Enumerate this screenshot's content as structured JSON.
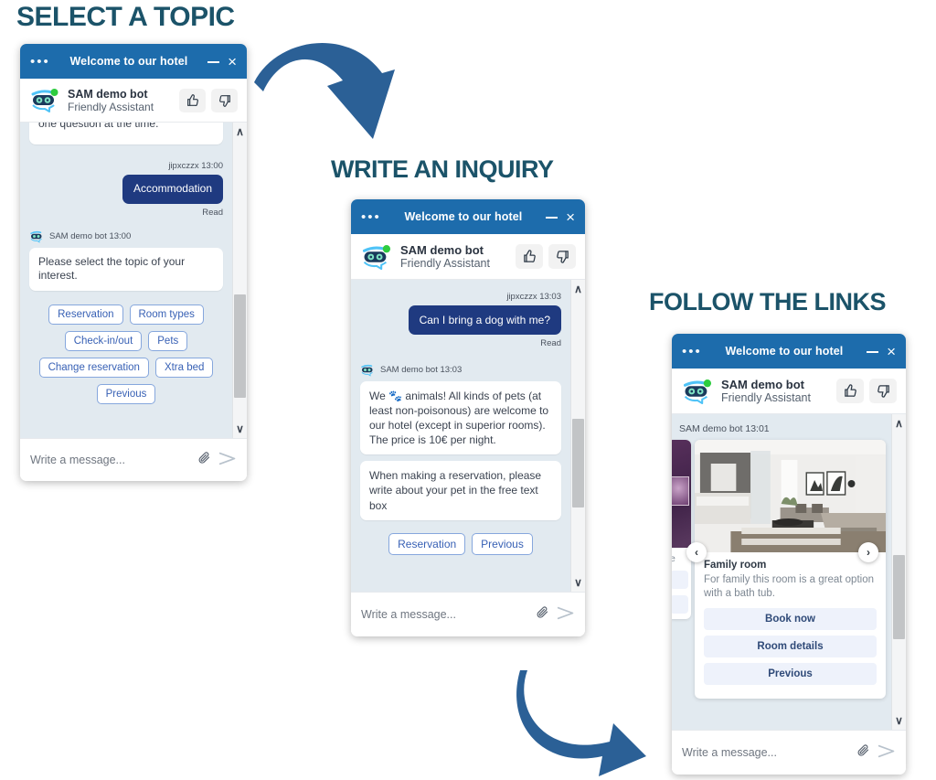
{
  "steps": [
    {
      "title": "SELECT A TOPIC"
    },
    {
      "title": "WRITE AN INQUIRY"
    },
    {
      "title": "FOLLOW THE LINKS"
    }
  ],
  "widget_common": {
    "header_title": "Welcome to our hotel",
    "menu_dots": "•••",
    "minimize_label": "Minimize",
    "close_label": "×",
    "bot_name": "SAM demo bot",
    "bot_role": "Friendly Assistant",
    "thumbs_up": "thumbs-up",
    "thumbs_down": "thumbs-down",
    "input_placeholder": "Write a message...",
    "attach_label": "📎",
    "send_label": "➤",
    "scroll_up": "∧",
    "scroll_down": "∨",
    "header_color": "#1d6cac",
    "user_bubble_color": "#1f3a80",
    "chip_border_color": "#86a7dd",
    "chip_text_color": "#3861b5",
    "body_color": "#e2eaf0",
    "title_color": "#1b5369",
    "arrow_color": "#2b6096"
  },
  "widget1": {
    "partial_message": "one question at the time.",
    "user_meta": "jipxczzx 13:00",
    "user_message": "Accommodation",
    "read_label": "Read",
    "bot_meta": "SAM demo bot 13:00",
    "bot_message": "Please select the topic of your interest.",
    "chips": [
      "Reservation",
      "Room types",
      "Check-in/out",
      "Pets",
      "Change reservation",
      "Xtra bed",
      "Previous"
    ]
  },
  "widget2": {
    "user_meta": "jipxczzx 13:03",
    "user_message": "Can I bring a dog with me?",
    "read_label": "Read",
    "bot_meta": "SAM demo bot 13:03",
    "bot_message_1": "We 🐾 animals! All kinds of pets (at least non-poisonous) are welcome to our hotel (except in superior rooms). The price is 10€ per night.",
    "bot_message_2": "When making a reservation, please write about your pet in the free text box",
    "chips": [
      "Reservation",
      "Previous"
    ],
    "input_value": ""
  },
  "widget3": {
    "bot_meta": "SAM demo bot 13:01",
    "card": {
      "title": "Family room",
      "description": "For family this room is a great option with a bath tub.",
      "buttons": [
        "Book now",
        "Room details",
        "Previous"
      ]
    },
    "nav_prev": "‹",
    "nav_next": "›",
    "peek_letter": "e"
  }
}
